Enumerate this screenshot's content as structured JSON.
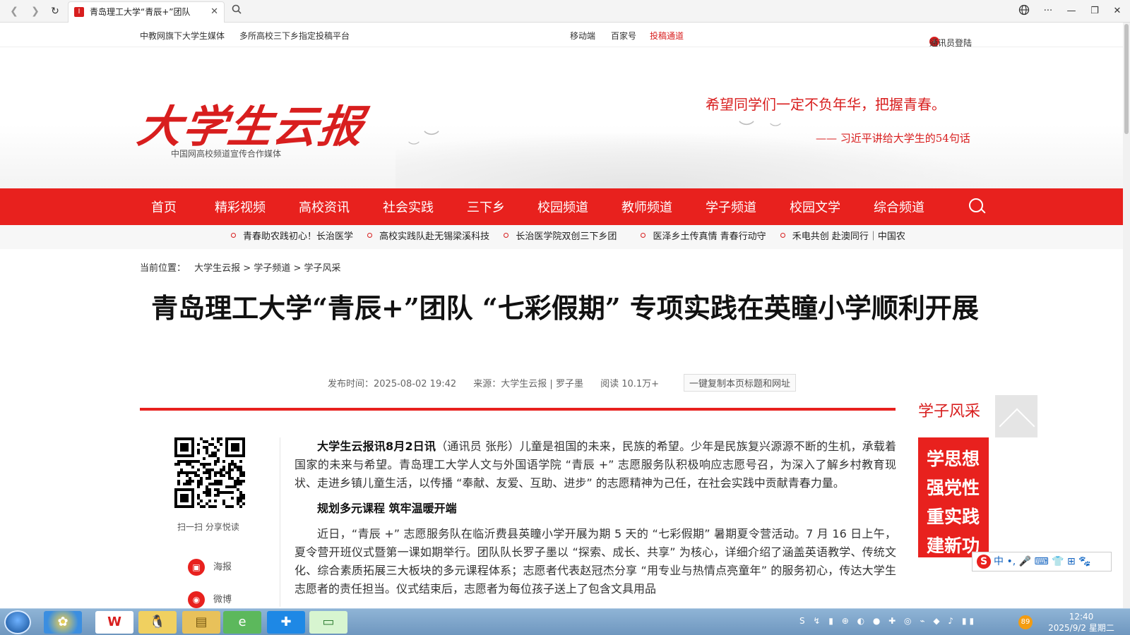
{
  "browser": {
    "tab_title": "青岛理工大学“青辰+”团队",
    "favicon_text": "I",
    "close_glyph": "✕",
    "more_glyph": "···",
    "min_glyph": "—",
    "restore_glyph": "❐",
    "win_close_glyph": "✕"
  },
  "topbar": {
    "left1": "中教网旗下大学生媒体",
    "left2": "多所高校三下乡指定投稿平台",
    "mid1": "移动端",
    "mid2": "百家号",
    "mid3": "投稿通道",
    "login": "通讯员登陆"
  },
  "header": {
    "logo": "大学生云报",
    "logo_sub": "中国网高校频道宣传合作媒体",
    "slogan": "希望同学们一定不负年华，把握青春。",
    "slogan_source": "—— 习近平讲给大学生的54句话"
  },
  "nav": {
    "items": [
      "首页",
      "精彩视频",
      "高校资讯",
      "社会实践",
      "三下乡",
      "校园频道",
      "教师频道",
      "学子频道",
      "校园文学",
      "综合频道"
    ]
  },
  "ticker": {
    "items": [
      "青春助农践初心！长治医学",
      "高校实践队赴无锡梁溪科技",
      "长治医学院双创三下乡团",
      "医泽乡土传真情 青春行动守",
      "禾电共创 赴澳同行｜中国农"
    ]
  },
  "breadcrumb": {
    "label": "当前位置：",
    "path": "大学生云报 > 学子频道 > 学子风采"
  },
  "article": {
    "title": "青岛理工大学“青辰+”团队 “七彩假期” 专项实践在英瞳小学顺利开展",
    "publish_time": "发布时间：2025-08-02 19:42",
    "source": "来源：大学生云报 | 罗子墨",
    "reads": "阅读 10.1万+",
    "copy_button": "一键复制本页标题和网址",
    "lead": "大学生云报讯8月2日讯",
    "para1": "（通讯员 张彤）儿童是祖国的未来，民族的希望。少年是民族复兴源源不断的生机，承载着国家的未来与希望。青岛理工大学人文与外国语学院 “青辰 +” 志愿服务队积极响应志愿号召，为深入了解乡村教育现状、走进乡镇儿童生活，以传播 “奉献、友爱、互助、进步” 的志愿精神为己任，在社会实践中贡献青春力量。",
    "heading1": "规划多元课程 筑牢温暖开端",
    "para2": "近日，“青辰 +” 志愿服务队在临沂费县英瞳小学开展为期 5 天的 “七彩假期” 暑期夏令营活动。7 月 16 日上午，夏令营开班仪式暨第一课如期举行。团队队长罗子墨以 “探索、成长、共享” 为核心，详细介绍了涵盖英语教学、传统文化、综合素质拓展三大板块的多元课程体系；志愿者代表赵冠杰分享 “用专业与热情点亮童年” 的服务初心，传达大学生志愿者的责任担当。仪式结束后，志愿者为每位孩子送上了包含文具用品"
  },
  "share": {
    "qr_label": "扫一扫 分享悦读",
    "poster": "海报",
    "weibo": "微博"
  },
  "sidebar": {
    "title": "学子风采",
    "banner_lines": [
      "学思想",
      "强党性",
      "重实践",
      "建新功"
    ]
  },
  "ime": {
    "logo": "S",
    "label": "中 •, 🎤 ⌨ 👕 ⊞ 🐾"
  },
  "taskbar": {
    "time": "12:40",
    "date": "2025/9/2 星期二",
    "tray_badge": "89"
  },
  "colors": {
    "brand_red": "#e8211e",
    "text_dark": "#111111"
  }
}
